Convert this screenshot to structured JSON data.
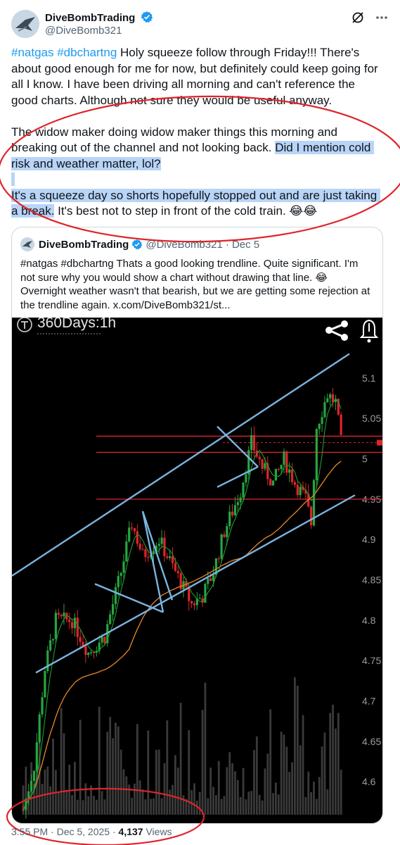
{
  "author": {
    "name": "DiveBombTrading",
    "handle": "@DiveBomb321"
  },
  "post": {
    "tags": "#natgas #dbchartng",
    "p1": " Holy squeeze follow through Friday!!! There's about good enough for me for now, but definitely could keep going for all I know. I have been driving all morning and can't reference the good charts. Although not sure they would be useful anyway.",
    "p2a": "The widow maker doing widow maker things this morning and breaking out of the channel and not looking back. ",
    "p2b": "Did I mention cold risk and weather matter, lol?",
    "p3a": "It's a squeeze day so shorts hopefully stopped out and are just taking a break.",
    "p3b": " It's best not to step in front of the cold train. 😂😂"
  },
  "quote": {
    "name": "DiveBombTrading",
    "handle": "@DiveBomb321",
    "date": "· Dec 5",
    "text": "#natgas #dbchartng Thats a good looking trendline. Quite significant. I'm not sure why you would show a chart without drawing that line. 😂Overnight weather wasn't that bearish, but we are getting some rejection at the trendline again.  x.com/DiveBomb321/st..."
  },
  "chart_data": {
    "type": "candlestick",
    "title": "360Days:1h",
    "y_ticks": [
      "5.1",
      "5.05",
      "5",
      "4.95",
      "4.9",
      "4.85",
      "4.8",
      "4.75",
      "4.7",
      "4.65",
      "4.6"
    ],
    "ylim": [
      4.56,
      5.14
    ],
    "horizontal_levels": [
      4.95,
      5.008,
      5.028
    ],
    "last_price": 5.02,
    "colors": {
      "up": "#26a641",
      "down": "#e0242b",
      "trendline": "#7bb4e0",
      "level": "#e0242b",
      "ma_fast": "#1f9d2f",
      "ma_slow": "#e8882a"
    }
  },
  "footer": {
    "time": "3:55 PM · Dec 5, 2025 · ",
    "views_count": "4,137",
    "views_label": " Views"
  },
  "icons": [
    "verified-badge-icon",
    "grok-icon",
    "more-icon",
    "share-icon",
    "alert-bell-icon",
    "ruler-icon"
  ]
}
